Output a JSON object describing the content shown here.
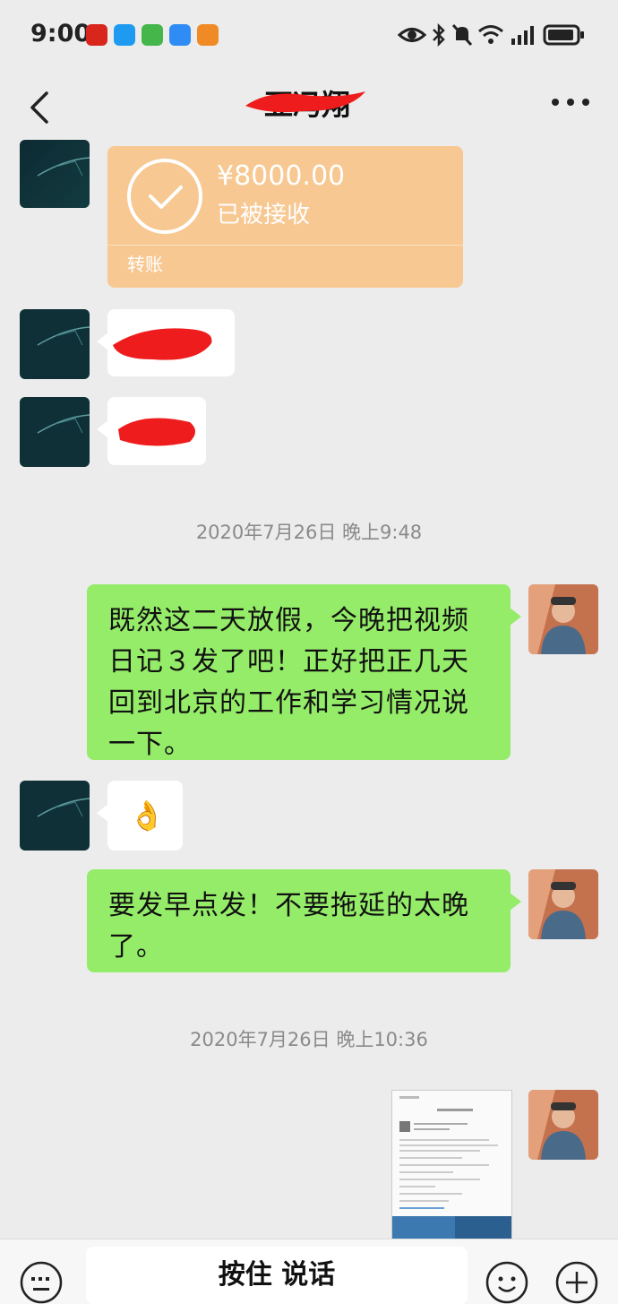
{
  "status": {
    "time": "9:00"
  },
  "header": {
    "title": "亚冯翔"
  },
  "messages": {
    "transfer": {
      "amount": "¥8000.00",
      "status": "已被接收",
      "kind": "转账"
    },
    "ts1": "2020年7月26日 晚上9:48",
    "green1": "既然这二天放假，今晚把视频日记３发了吧！正好把正几天回到北京的工作和学习情况说一下。",
    "ok_emoji": "👌",
    "green2": "要发早点发！不要拖延的太晚了。",
    "ts2": "2020年7月26日 晚上10:36"
  },
  "bottom": {
    "hold_to_talk": "按住 说话"
  },
  "colors": {
    "green_bubble": "#95ec69",
    "transfer_bg": "#f7c892",
    "redaction": "#ee1c1c"
  }
}
